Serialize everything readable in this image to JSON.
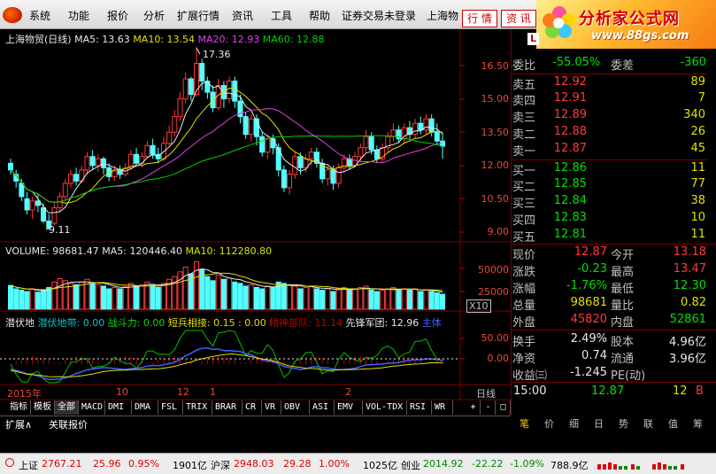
{
  "menu": {
    "items": [
      "系统",
      "功能",
      "报价",
      "分析",
      "扩展行情",
      "资讯",
      "工具",
      "帮助",
      "证券交易未登录",
      "上海物"
    ],
    "buttons": [
      "行 情",
      "资 讯"
    ]
  },
  "brand": {
    "title": "分析家公式网",
    "url": "www.88gs.com"
  },
  "chart": {
    "header": {
      "name": "上海物贸(日线)",
      "ma5": "MA5: 13.63",
      "ma10": "MA10: 13.54",
      "ma20": "MA20: 12.93",
      "ma60": "MA60: 12.88"
    },
    "high_label": "17.36",
    "low_label": "9.11",
    "price_axis": [
      "16.50",
      "15.00",
      "13.50",
      "12.00",
      "10.50",
      "9.00"
    ],
    "volume_header": {
      "vol": "VOLUME: 98681.47",
      "ma5": "MA5: 120446.40",
      "ma10": "MA10: 112280.80"
    },
    "volume_axis": [
      "50000",
      "25000"
    ],
    "volume_unit": "X10",
    "indicator_header": {
      "a": "潜伏地",
      "b": "潜伏地带: 0.00",
      "c": "战斗力: 0.00",
      "d": "短兵相接: 0.15 : 0.00",
      "e": "精神部队: 11.14",
      "f": "先锋军团: 12.96",
      "g": "主体"
    },
    "indicator_axis": [
      "50.00",
      "0.00"
    ],
    "date_axis": [
      "2015年",
      "10",
      "12",
      "1",
      "2"
    ],
    "period_label": "日线",
    "colors": {
      "up": "#ff3a3a",
      "down": "#54ffff",
      "ma5": "#e8e8e8",
      "ma10": "#e0e000",
      "ma20": "#e040e0",
      "ma60": "#00d000"
    }
  },
  "tabs": {
    "items": [
      "指标",
      "模板",
      "全部",
      "MACD",
      "DMI",
      "DMA",
      "FSL",
      "TRIX",
      "BRAR",
      "CR",
      "VR",
      "OBV",
      "ASI",
      "EMV",
      "VOL-TDX",
      "RSI",
      "WR"
    ],
    "active": "全部",
    "controls": [
      "+",
      "-",
      "□"
    ]
  },
  "subtabs": [
    "扩展∧",
    "关联报价"
  ],
  "quote": {
    "weibi_label": "委比",
    "weibi": "-55.05%",
    "weicha_label": "委差",
    "weicha": "-360",
    "asks": [
      {
        "label": "卖五",
        "price": "12.92",
        "vol": "89"
      },
      {
        "label": "卖四",
        "price": "12.91",
        "vol": "7"
      },
      {
        "label": "卖三",
        "price": "12.89",
        "vol": "340"
      },
      {
        "label": "卖二",
        "price": "12.88",
        "vol": "26"
      },
      {
        "label": "卖一",
        "price": "12.87",
        "vol": "45"
      }
    ],
    "bids": [
      {
        "label": "买一",
        "price": "12.86",
        "vol": "11"
      },
      {
        "label": "买二",
        "price": "12.85",
        "vol": "77"
      },
      {
        "label": "买三",
        "price": "12.84",
        "vol": "38"
      },
      {
        "label": "买四",
        "price": "12.83",
        "vol": "10"
      },
      {
        "label": "买五",
        "price": "12.81",
        "vol": "11"
      }
    ],
    "stats": [
      {
        "l1": "现价",
        "v1": "12.87",
        "c1": "up",
        "l2": "今开",
        "v2": "13.18",
        "c2": "up"
      },
      {
        "l1": "涨跌",
        "v1": "-0.23",
        "c1": "dn",
        "l2": "最高",
        "v2": "13.47",
        "c2": "up"
      },
      {
        "l1": "涨幅",
        "v1": "-1.76%",
        "c1": "dn",
        "l2": "最低",
        "v2": "12.30",
        "c2": "dn"
      },
      {
        "l1": "总量",
        "v1": "98681",
        "c1": "yl",
        "l2": "量比",
        "v2": "0.82",
        "c2": "yl"
      },
      {
        "l1": "外盘",
        "v1": "45820",
        "c1": "up",
        "l2": "内盘",
        "v2": "52861",
        "c2": "dn"
      }
    ],
    "fin": [
      {
        "l1": "换手",
        "v1": "2.49%",
        "l2": "股本",
        "v2": "4.96亿"
      },
      {
        "l1": "净资",
        "v1": "0.74",
        "l2": "流通",
        "v2": "3.96亿"
      },
      {
        "l1": "收益㈢",
        "v1": "-1.245",
        "l2": "PE(动)",
        "v2": ""
      }
    ],
    "tick": {
      "time": "15:00",
      "price": "12.87",
      "vol": "12",
      "side": "B"
    },
    "rtabs": [
      "笔",
      "价",
      "细",
      "日",
      "势",
      "联",
      "值",
      "筹"
    ]
  },
  "statusbar": {
    "sh_label": "上证",
    "sh_val": "2767.21",
    "sh_chg": "25.96",
    "sh_pct": "0.95%",
    "sh_amt": "1901亿",
    "sz_label": "沪深",
    "sz_val": "2948.03",
    "sz_chg": "29.28",
    "sz_pct": "1.00%",
    "sz_amt": "1025亿",
    "cy_label": "创业",
    "cy_val": "2014.92",
    "cy_chg": "-22.22",
    "cy_pct": "-1.09%",
    "cy_amt": "788.9亿"
  },
  "candles": [
    [
      12.1,
      11.8,
      12.3,
      11.6
    ],
    [
      11.6,
      11.3,
      11.8,
      11.0
    ],
    [
      11.2,
      10.6,
      11.4,
      10.4
    ],
    [
      10.5,
      10.0,
      10.8,
      9.8
    ],
    [
      10.0,
      10.4,
      10.6,
      9.6
    ],
    [
      10.4,
      10.2,
      10.7,
      9.9
    ],
    [
      10.1,
      9.5,
      10.3,
      9.4
    ],
    [
      9.5,
      9.2,
      9.8,
      9.1
    ],
    [
      9.4,
      10.1,
      10.3,
      9.3
    ],
    [
      10.1,
      10.6,
      10.8,
      9.9
    ],
    [
      10.6,
      11.2,
      11.4,
      10.4
    ],
    [
      11.2,
      11.6,
      11.8,
      11.0
    ],
    [
      11.6,
      11.3,
      11.9,
      11.1
    ],
    [
      11.3,
      11.8,
      12.0,
      11.2
    ],
    [
      11.8,
      12.4,
      12.6,
      11.6
    ],
    [
      12.4,
      12.0,
      12.7,
      11.8
    ],
    [
      12.0,
      12.3,
      12.5,
      11.7
    ],
    [
      12.3,
      11.9,
      12.4,
      11.6
    ],
    [
      11.9,
      11.5,
      12.1,
      11.3
    ],
    [
      11.5,
      11.8,
      12.0,
      11.3
    ],
    [
      11.8,
      11.6,
      12.0,
      11.4
    ],
    [
      11.6,
      11.9,
      12.1,
      11.5
    ],
    [
      11.9,
      12.5,
      12.7,
      11.8
    ],
    [
      12.5,
      12.1,
      12.8,
      12.0
    ],
    [
      12.1,
      12.4,
      12.6,
      11.9
    ],
    [
      12.4,
      12.9,
      13.1,
      12.3
    ],
    [
      12.9,
      12.5,
      13.2,
      12.3
    ],
    [
      12.5,
      12.3,
      12.8,
      12.1
    ],
    [
      12.3,
      13.0,
      13.3,
      12.2
    ],
    [
      13.0,
      13.5,
      13.8,
      12.9
    ],
    [
      13.5,
      14.2,
      14.5,
      13.3
    ],
    [
      14.2,
      15.0,
      15.3,
      14.0
    ],
    [
      15.0,
      15.9,
      16.2,
      14.8
    ],
    [
      15.9,
      15.2,
      16.0,
      14.9
    ],
    [
      15.2,
      16.6,
      17.36,
      15.1
    ],
    [
      16.6,
      15.8,
      16.8,
      15.4
    ],
    [
      15.8,
      15.3,
      16.0,
      15.0
    ],
    [
      15.3,
      14.6,
      15.6,
      14.4
    ],
    [
      14.6,
      15.6,
      15.9,
      14.5
    ],
    [
      15.6,
      15.0,
      15.8,
      14.6
    ],
    [
      15.0,
      15.8,
      16.0,
      14.8
    ],
    [
      15.8,
      14.9,
      16.0,
      14.6
    ],
    [
      14.9,
      14.2,
      15.2,
      13.9
    ],
    [
      14.2,
      13.4,
      14.4,
      13.2
    ],
    [
      13.4,
      14.1,
      14.3,
      13.1
    ],
    [
      14.1,
      13.3,
      14.3,
      12.9
    ],
    [
      13.3,
      12.6,
      13.5,
      12.4
    ],
    [
      12.6,
      13.2,
      13.4,
      12.3
    ],
    [
      13.2,
      12.8,
      13.4,
      12.5
    ],
    [
      12.8,
      11.8,
      13.0,
      11.5
    ],
    [
      11.8,
      11.0,
      12.0,
      10.8
    ],
    [
      11.0,
      11.6,
      11.8,
      10.7
    ],
    [
      11.6,
      12.4,
      12.6,
      11.4
    ],
    [
      12.4,
      11.9,
      12.6,
      11.6
    ],
    [
      11.9,
      12.3,
      12.5,
      11.7
    ],
    [
      12.3,
      12.6,
      12.8,
      12.0
    ],
    [
      12.6,
      12.1,
      12.8,
      11.9
    ],
    [
      12.1,
      11.4,
      12.3,
      11.2
    ],
    [
      11.4,
      11.8,
      12.0,
      11.1
    ],
    [
      11.8,
      11.2,
      12.0,
      10.9
    ],
    [
      11.2,
      11.9,
      12.1,
      11.0
    ],
    [
      11.9,
      12.3,
      12.5,
      11.7
    ],
    [
      12.3,
      12.0,
      12.5,
      11.8
    ],
    [
      12.0,
      12.4,
      12.6,
      11.9
    ],
    [
      12.4,
      12.8,
      13.0,
      12.2
    ],
    [
      12.8,
      13.3,
      13.6,
      12.6
    ],
    [
      13.3,
      12.7,
      13.5,
      12.5
    ],
    [
      12.7,
      12.3,
      12.9,
      12.1
    ],
    [
      12.3,
      12.8,
      13.0,
      12.1
    ],
    [
      12.8,
      13.3,
      13.5,
      12.6
    ],
    [
      13.3,
      13.6,
      13.9,
      13.1
    ],
    [
      13.6,
      13.2,
      13.8,
      13.0
    ],
    [
      13.2,
      13.7,
      13.9,
      13.0
    ],
    [
      13.7,
      13.4,
      14.0,
      13.2
    ],
    [
      13.4,
      13.9,
      14.1,
      13.2
    ],
    [
      13.9,
      13.6,
      14.2,
      13.4
    ],
    [
      13.6,
      14.1,
      14.3,
      13.4
    ],
    [
      14.1,
      13.5,
      14.3,
      13.3
    ],
    [
      13.5,
      13.1,
      13.9,
      12.9
    ],
    [
      13.1,
      12.87,
      13.47,
      12.3
    ]
  ],
  "volumes": [
    35,
    30,
    28,
    26,
    30,
    25,
    28,
    32,
    40,
    45,
    42,
    38,
    36,
    40,
    44,
    38,
    36,
    34,
    30,
    32,
    30,
    33,
    38,
    34,
    36,
    40,
    35,
    32,
    38,
    44,
    48,
    55,
    62,
    52,
    70,
    58,
    48,
    42,
    50,
    44,
    46,
    40,
    38,
    34,
    36,
    32,
    30,
    34,
    32,
    40,
    38,
    36,
    34,
    30,
    32,
    34,
    30,
    28,
    30,
    26,
    30,
    32,
    28,
    30,
    32,
    34,
    28,
    26,
    28,
    30,
    32,
    28,
    30,
    28,
    30,
    26,
    28,
    26,
    24,
    22
  ]
}
